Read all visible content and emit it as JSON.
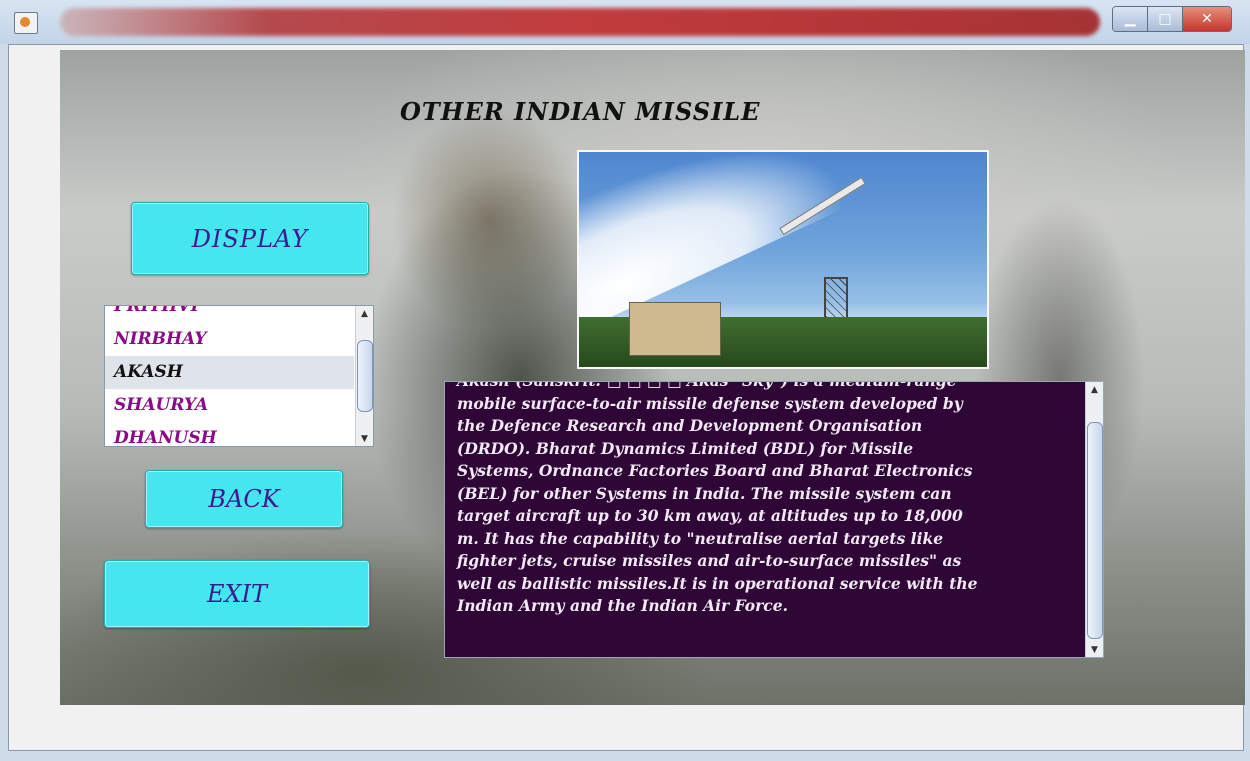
{
  "window": {
    "title": "",
    "buttons": {
      "minimize": "▁",
      "maximize": "□",
      "close": "✕"
    }
  },
  "page_title": "OTHER INDIAN  MISSILE",
  "buttons": {
    "display": "DISPLAY",
    "back": "BACK",
    "exit": "EXIT"
  },
  "missile_list": {
    "items": [
      {
        "label": "PRITHVI"
      },
      {
        "label": "NIRBHAY"
      },
      {
        "label": "AKASH"
      },
      {
        "label": "SHAURYA"
      },
      {
        "label": "DHANUSH"
      }
    ],
    "selected": "AKASH"
  },
  "description": {
    "lines": [
      "Akash (Sanskrit: □ □ □ □ Ākāś \"Sky\") is a medium-range",
      "mobile surface-to-air missile defense system developed by",
      "the Defence Research and Development Organisation",
      "(DRDO). Bharat Dynamics Limited (BDL) for Missile",
      "Systems, Ordnance Factories Board and Bharat Electronics",
      "(BEL) for other Systems in India. The missile system can",
      "target aircraft up to 30 km away, at altitudes up to 18,000",
      "m. It has the capability to \"neutralise aerial targets like",
      "fighter jets, cruise missiles and air-to-surface missiles\" as",
      "well as ballistic missiles.It is in operational service with the",
      "Indian Army and the Indian Air Force."
    ]
  },
  "scrollbar": {
    "up_arrow": "▲",
    "down_arrow": "▼"
  },
  "colors": {
    "button_bg": "#46e6ee",
    "button_text": "#3c1a8f",
    "list_text": "#8a0a8a",
    "description_bg": "#2f0736",
    "titlebar_accent": "#c12b2b"
  }
}
